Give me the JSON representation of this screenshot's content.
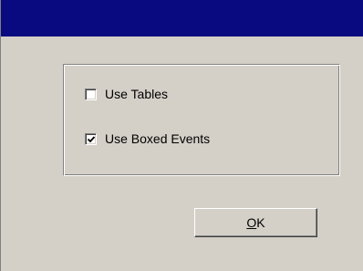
{
  "window": {
    "title": "",
    "titlebar_color": "#0a0a80",
    "background_color": "#d4d0c8"
  },
  "options": [
    {
      "label": "Use Tables",
      "checked": false
    },
    {
      "label": "Use Boxed Events",
      "checked": true
    }
  ],
  "ok_button": {
    "accel": "O",
    "rest": "K"
  }
}
